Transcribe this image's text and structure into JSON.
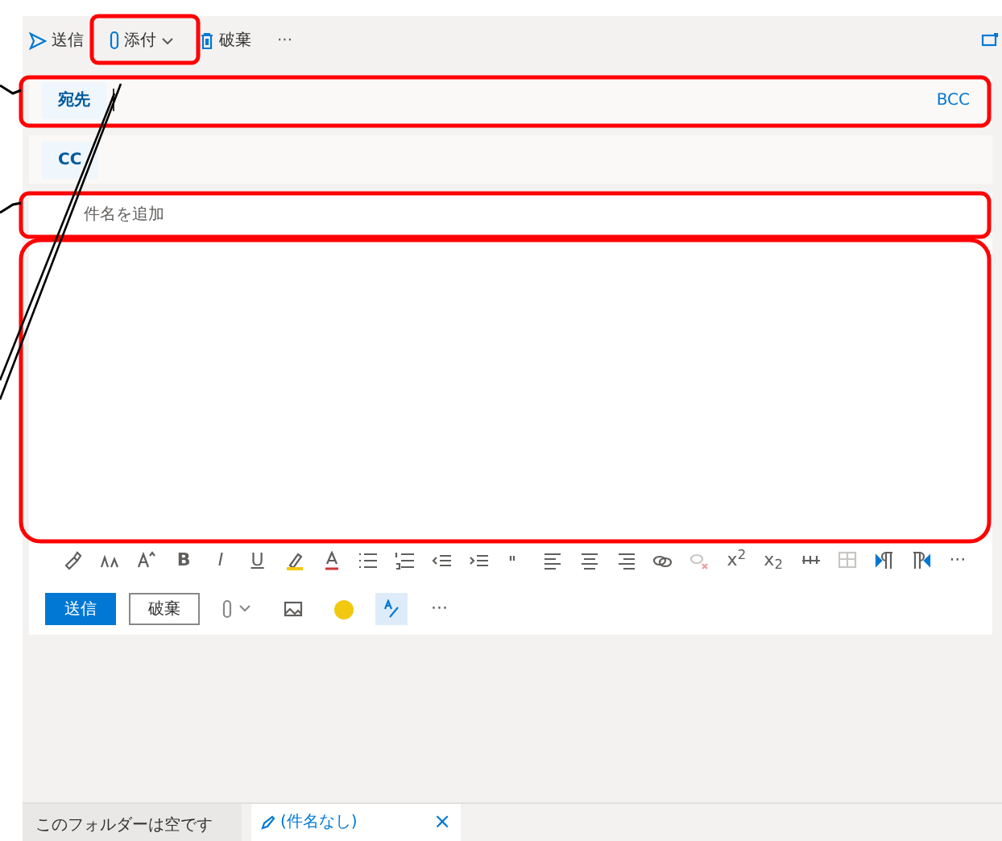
{
  "toolbar": {
    "items": [
      {
        "kind": "send",
        "label": "送信"
      },
      {
        "kind": "attach",
        "label": "添付"
      },
      {
        "kind": "discard",
        "label": "破棄"
      },
      {
        "kind": "more",
        "label": "···"
      }
    ]
  },
  "to": {
    "label": "宛先"
  },
  "bcc": "BCC",
  "cc": {
    "label": "CC"
  },
  "subject": {
    "placeholder": "件名を追加"
  },
  "format_toolbar": {
    "glyphs": [
      "B",
      "I",
      "U",
      "x$^{2}$",
      "x$_{2}$",
      "···"
    ]
  },
  "actions": {
    "send": "送信",
    "discard": "破棄",
    "more": "···",
    "editor_on": true
  },
  "folder_status": "このフォルダーは空です",
  "draft_tab": {
    "title": "(件名なし)",
    "close": "×"
  }
}
